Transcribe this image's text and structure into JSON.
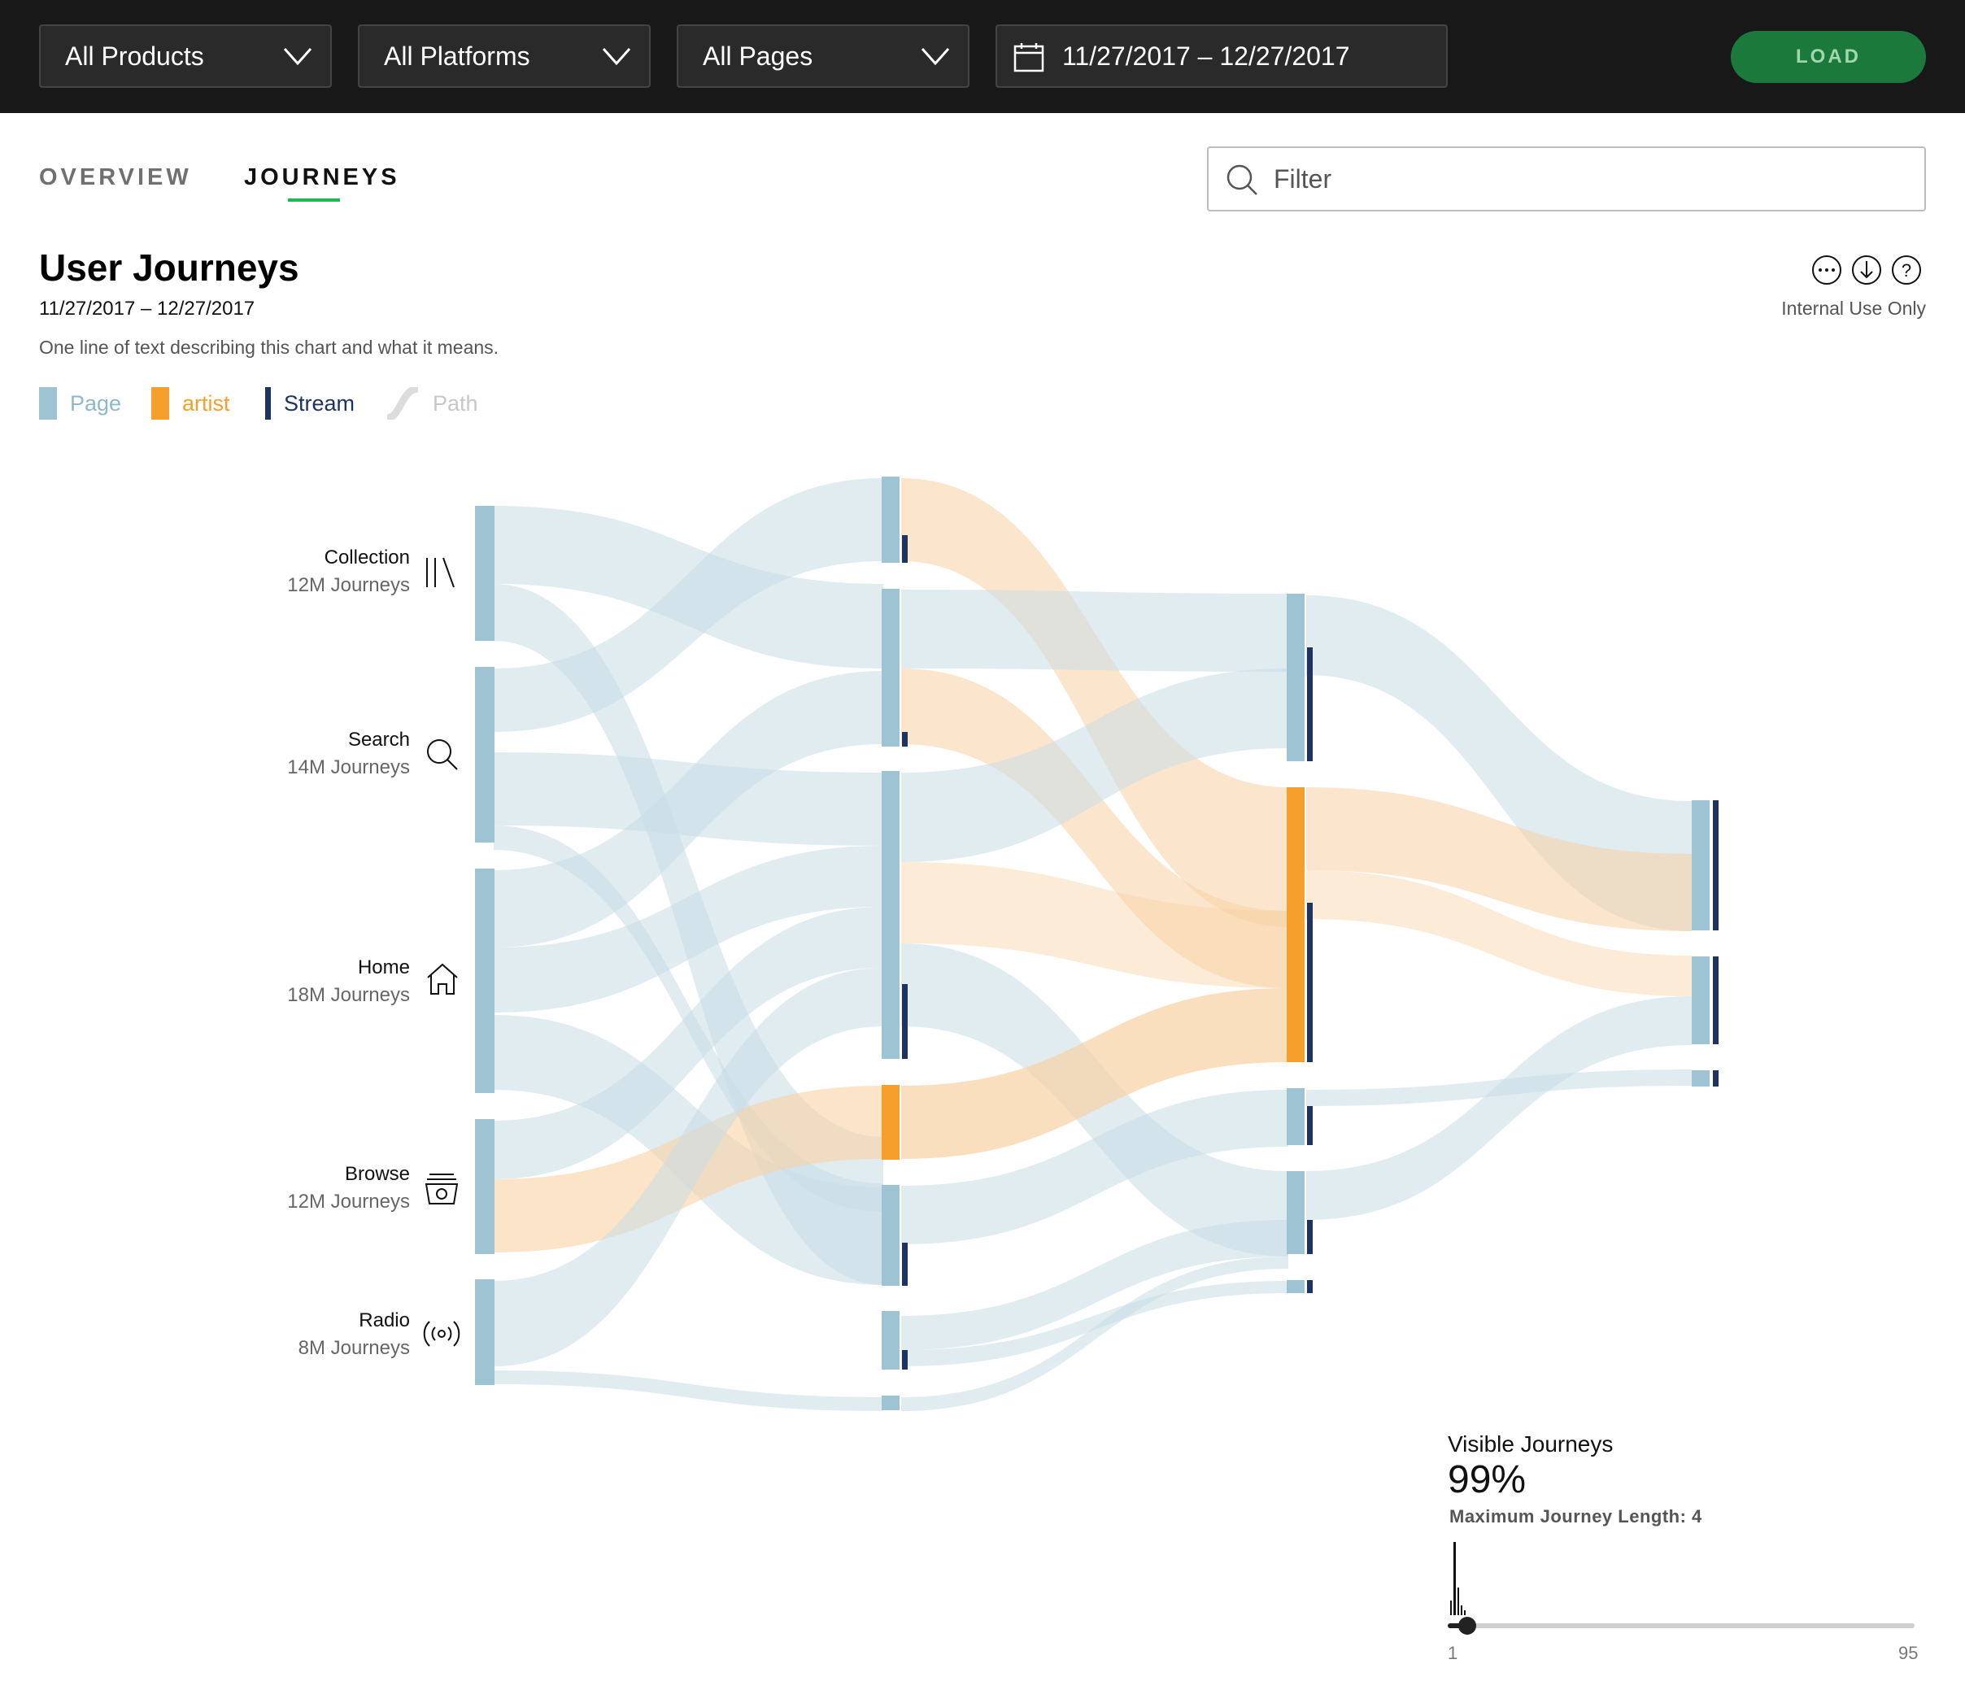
{
  "toolbar": {
    "products": "All Products",
    "platforms": "All Platforms",
    "pages": "All Pages",
    "date_range": "11/27/2017 – 12/27/2017",
    "load_label": "LOAD"
  },
  "tabs": [
    {
      "label": "OVERVIEW",
      "active": false
    },
    {
      "label": "JOURNEYS",
      "active": true
    }
  ],
  "filter": {
    "placeholder": "Filter"
  },
  "header": {
    "title": "User Journeys",
    "date_range": "11/27/2017 – 12/27/2017",
    "description": "One line of text describing this chart and what it means.",
    "internal_note": "Internal Use Only",
    "icons": [
      "more-icon",
      "download-icon",
      "help-icon"
    ]
  },
  "legend": [
    {
      "label": "Page",
      "color": "#9ec3d3"
    },
    {
      "label": "artist",
      "color": "#f5a02c"
    },
    {
      "label": "Stream",
      "color": "#1f3360"
    },
    {
      "label": "Path",
      "color": "#dcdcdc"
    }
  ],
  "chart_data": {
    "type": "sankey",
    "sources": [
      {
        "name": "Collection",
        "count": "12M Journeys",
        "icon": "library-icon"
      },
      {
        "name": "Search",
        "count": "14M Journeys",
        "icon": "search-icon"
      },
      {
        "name": "Home",
        "count": "18M Journeys",
        "icon": "home-icon"
      },
      {
        "name": "Browse",
        "count": "12M Journeys",
        "icon": "browse-icon"
      },
      {
        "name": "Radio",
        "count": "8M Journeys",
        "icon": "radio-icon"
      }
    ],
    "steps": 4,
    "colors": {
      "page": "#9ec3d3",
      "artist": "#f5a02c",
      "stream": "#1f3360",
      "path": "#c9dde6",
      "artist_path": "#f8d2a4"
    }
  },
  "visible_journeys": {
    "label": "Visible Journeys",
    "value": "99%",
    "max_label": "Maximum Journey Length: 4",
    "slider_min": "1",
    "slider_max": "95",
    "slider_value": 4
  }
}
